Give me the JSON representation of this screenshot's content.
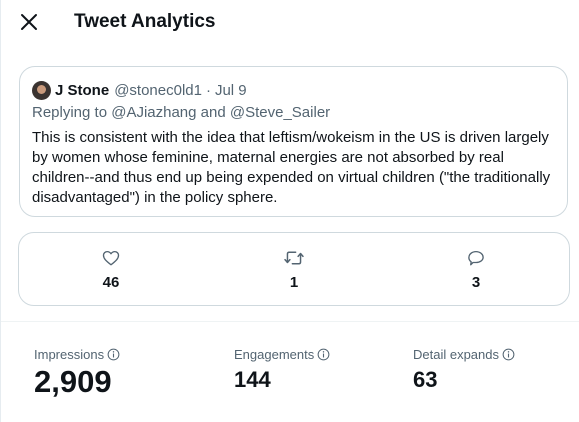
{
  "header": {
    "title": "Tweet Analytics"
  },
  "tweet": {
    "author_name": "J Stone",
    "author_handle": "@stonec0ld1",
    "separator": "·",
    "date": "Jul 9",
    "replying_prefix": "Replying to",
    "reply_to_1": "@AJiazhang",
    "reply_and": "and",
    "reply_to_2": "@Steve_Sailer",
    "text": "This is consistent with the idea that leftism/wokeism in the US is driven largely by women whose feminine, maternal energies are not absorbed by real children--and thus end up being expended on virtual children (\"the traditionally disadvantaged\") in the policy sphere."
  },
  "actions": {
    "likes": "46",
    "retweets": "1",
    "replies": "3"
  },
  "stats": {
    "impressions_label": "Impressions",
    "impressions_value": "2,909",
    "engagements_label": "Engagements",
    "engagements_value": "144",
    "detail_expands_label": "Detail expands",
    "detail_expands_value": "63"
  },
  "icons": {
    "close": "close-icon",
    "like": "heart-icon",
    "retweet": "retweet-icon",
    "reply": "reply-icon",
    "info": "info-icon"
  },
  "colors": {
    "text_primary": "#0f1419",
    "text_secondary": "#536471",
    "border": "#cfd9de"
  }
}
